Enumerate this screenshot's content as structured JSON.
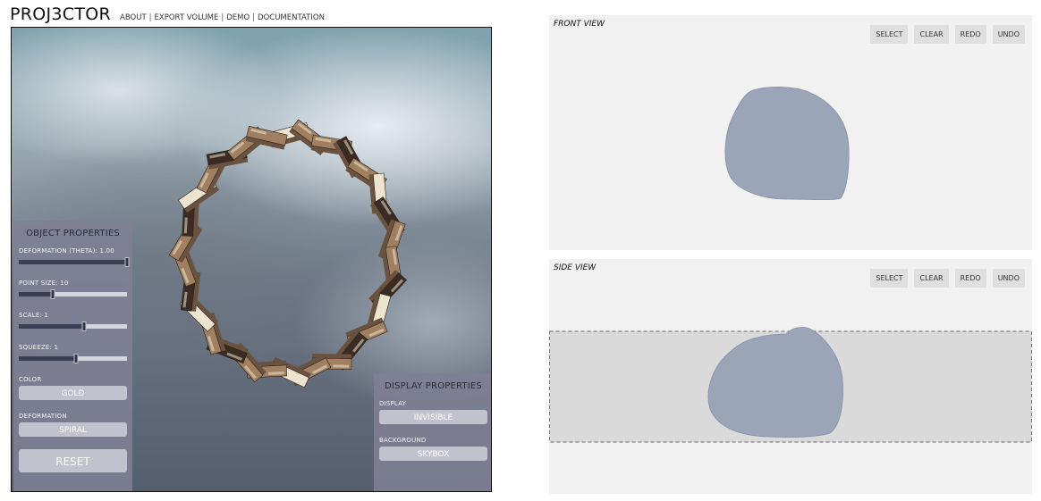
{
  "app": {
    "title": "PROJ3CTOR",
    "nav": [
      "ABOUT",
      "EXPORT VOLUME",
      "DEMO",
      "DOCUMENTATION"
    ],
    "nav_separator": "|"
  },
  "object_properties": {
    "title": "OBJECT PROPERTIES",
    "deformation_label": "DEFORMATION (THETA): 1.00",
    "deformation_level": 1.0,
    "point_size_label": "POINT SIZE: 10",
    "point_size_level": 0.31,
    "scale_label": "SCALE: 1",
    "scale_level": 0.6,
    "squeeze_label": "SQUEEZE: 1",
    "squeeze_level": 0.53,
    "color_label": "COLOR",
    "color_value": "GOLD",
    "deformation_type_label": "DEFORMATION",
    "deformation_type_value": "SPIRAL",
    "reset_label": "RESET"
  },
  "display_properties": {
    "title": "DISPLAY PROPERTIES",
    "display_label": "DISPLAY",
    "display_value": "INVISIBLE",
    "background_label": "BACKGROUND",
    "background_value": "SKYBOX"
  },
  "front_view": {
    "title": "FRONT VIEW",
    "buttons": [
      "SELECT",
      "CLEAR",
      "REDO",
      "UNDO"
    ]
  },
  "side_view": {
    "title": "SIDE VIEW",
    "buttons": [
      "SELECT",
      "CLEAR",
      "REDO",
      "UNDO"
    ]
  },
  "colors": {
    "shape_fill": "#9aa5b8",
    "view_bg": "#f1f1f1",
    "selection_bg": "#dadada",
    "panel_bg": "#80809a",
    "block_light": "#ece4cf",
    "block_mid": "#a08060",
    "block_dark": "#3a2c22"
  }
}
